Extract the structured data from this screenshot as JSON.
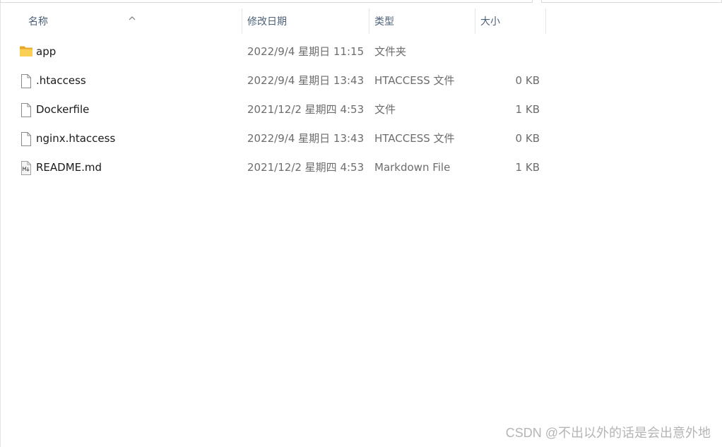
{
  "columns": {
    "name": "名称",
    "date": "修改日期",
    "type": "类型",
    "size": "大小"
  },
  "sort": {
    "column": "name",
    "direction": "ascending",
    "icon": "sort-caret-up-icon"
  },
  "files": [
    {
      "name": "app",
      "date": "2022/9/4 星期日 11:15",
      "type": "文件夹",
      "size": "",
      "icon": "folder-icon"
    },
    {
      "name": ".htaccess",
      "date": "2022/9/4 星期日 13:43",
      "type": "HTACCESS 文件",
      "size": "0 KB",
      "icon": "file-icon"
    },
    {
      "name": "Dockerfile",
      "date": "2021/12/2 星期四 4:53",
      "type": "文件",
      "size": "1 KB",
      "icon": "file-icon"
    },
    {
      "name": "nginx.htaccess",
      "date": "2022/9/4 星期日 13:43",
      "type": "HTACCESS 文件",
      "size": "0 KB",
      "icon": "file-icon"
    },
    {
      "name": "README.md",
      "date": "2021/12/2 星期四 4:53",
      "type": "Markdown File",
      "size": "1 KB",
      "icon": "markdown-file-icon"
    }
  ],
  "watermark": "CSDN @不出以外的话是会出意外地",
  "colors": {
    "header_text": "#4c607a",
    "name_text": "#1a1a1a",
    "meta_text": "#6d6d6d",
    "folder": "#f5c242"
  }
}
